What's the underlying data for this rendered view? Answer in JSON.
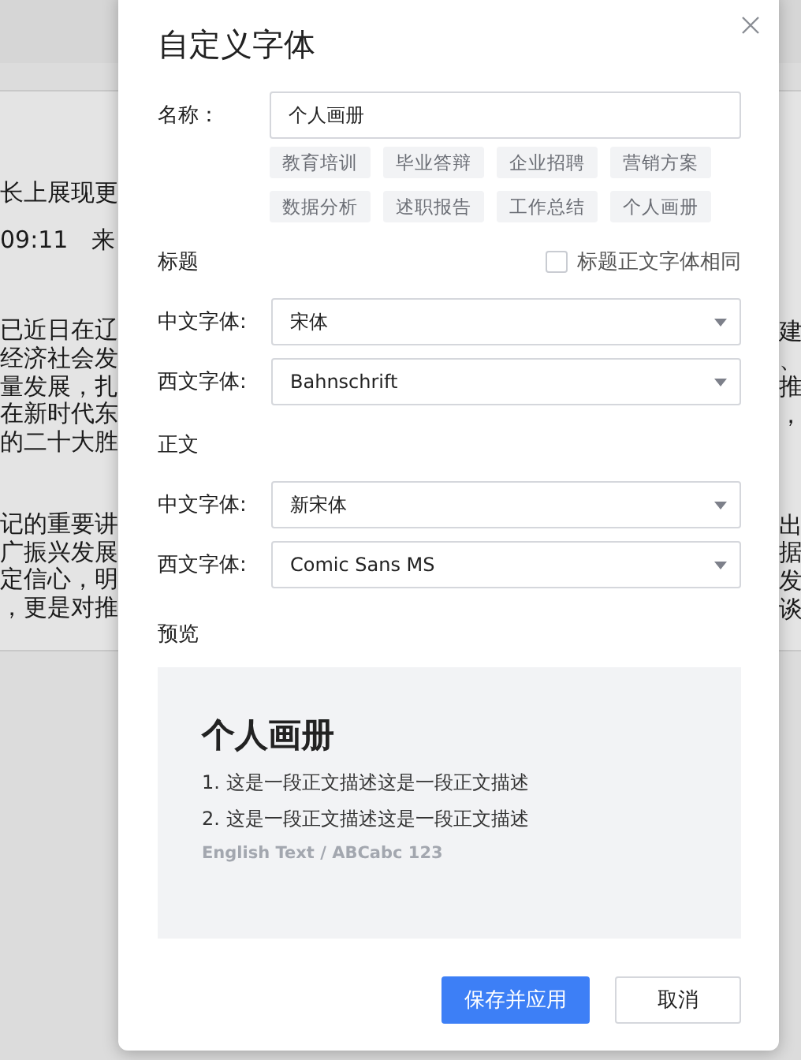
{
  "background_document": {
    "left_paragraphs": [
      [
        "长上展现更"
      ],
      [
        "09:11　来"
      ],
      [
        "已近日在辽",
        "经济社会发",
        "量发展，扎",
        "在新时代东",
        "的二十大胜"
      ],
      [
        "记的重要讲",
        "广振兴发展",
        "定信心，明",
        "，更是对推"
      ]
    ],
    "right_paragraphs": [
      [
        "建",
        "、",
        "推",
        "，"
      ],
      [
        "出",
        "据",
        "发",
        "谈"
      ]
    ]
  },
  "dialog": {
    "title": "自定义字体",
    "name_field": {
      "label": "名称：",
      "value": "个人画册"
    },
    "presets": [
      "教育培训",
      "毕业答辩",
      "企业招聘",
      "营销方案",
      "数据分析",
      "述职报告",
      "工作总结",
      "个人画册"
    ],
    "heading_section": {
      "title": "标题",
      "same_font_option": {
        "label": "标题正文字体相同",
        "checked": false
      },
      "fields": [
        {
          "label": "中文字体:",
          "value": "宋体"
        },
        {
          "label": "西文字体:",
          "value": "Bahnschrift"
        }
      ]
    },
    "body_section": {
      "title": "正文",
      "fields": [
        {
          "label": "中文字体:",
          "value": "新宋体"
        },
        {
          "label": "西文字体:",
          "value": "Comic Sans MS"
        }
      ]
    },
    "preview": {
      "title": "预览",
      "heading": "个人画册",
      "lines": [
        "1. 这是一段正文描述这是一段正文描述",
        "2. 这是一段正文描述这是一段正文描述"
      ],
      "sample": "English Text / ABCabc 123"
    },
    "buttons": [
      {
        "label": "保存并应用",
        "kind": "primary"
      },
      {
        "label": "取消",
        "kind": "secondary"
      }
    ]
  }
}
